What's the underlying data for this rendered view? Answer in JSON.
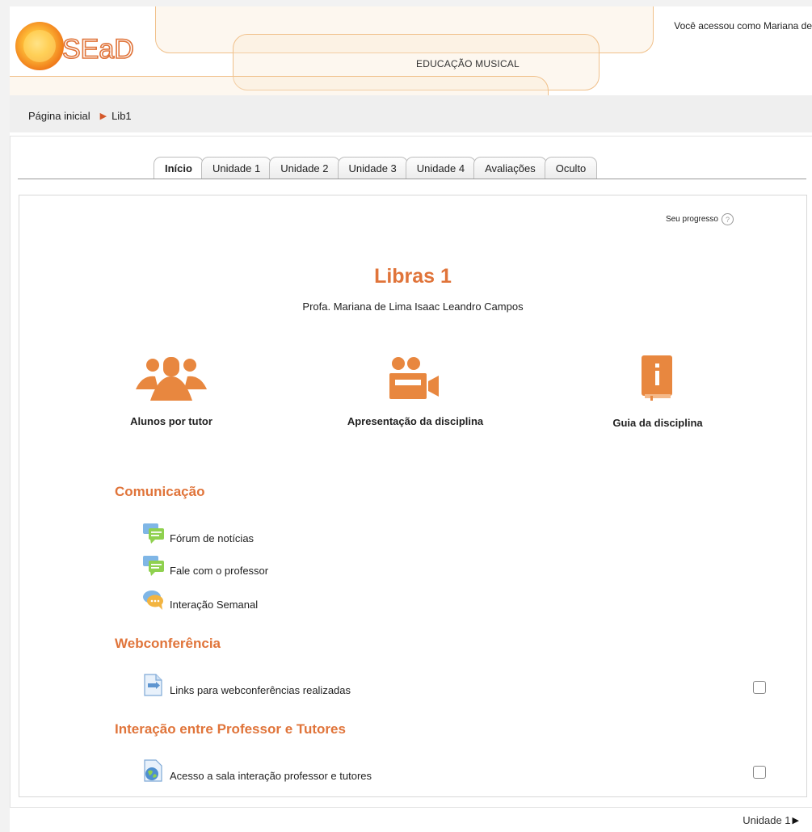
{
  "header": {
    "logo_text": "SEaD",
    "user_text": "Você acessou como Mariana de",
    "course_category": "EDUCAÇÃO MUSICAL"
  },
  "breadcrumb": {
    "home": "Página inicial",
    "current": "Lib1"
  },
  "tabs": [
    {
      "label": "Início",
      "active": true
    },
    {
      "label": "Unidade 1",
      "active": false
    },
    {
      "label": "Unidade 2",
      "active": false
    },
    {
      "label": "Unidade 3",
      "active": false
    },
    {
      "label": "Unidade 4",
      "active": false
    },
    {
      "label": "Avaliações",
      "active": false
    },
    {
      "label": "Oculto",
      "active": false
    }
  ],
  "progress": {
    "label": "Seu progresso",
    "help_icon": "?"
  },
  "course": {
    "title": "Libras 1",
    "teacher": "Profa. Mariana de Lima Isaac Leandro Campos"
  },
  "features": [
    {
      "label": "Alunos por tutor",
      "icon": "group-icon"
    },
    {
      "label": "Apresentação da disciplina",
      "icon": "video-camera-icon"
    },
    {
      "label": "Guia da disciplina",
      "icon": "book-info-icon"
    }
  ],
  "sections": [
    {
      "title": "Comunicação",
      "items": [
        {
          "label": "Fórum de notícias",
          "icon": "forum-icon"
        },
        {
          "label": "Fale com o professor",
          "icon": "forum-icon"
        },
        {
          "label": "Interação Semanal",
          "icon": "chat-icon"
        }
      ]
    },
    {
      "title": "Webconferência",
      "items": [
        {
          "label": "Links para webconferências realizadas",
          "icon": "url-icon",
          "checkbox": true
        }
      ]
    },
    {
      "title": "Interação entre Professor e Tutores",
      "items": [
        {
          "label": "Acesso a sala interação professor e tutores",
          "icon": "globe-icon",
          "checkbox": true
        }
      ]
    }
  ],
  "footer": {
    "next_label": "Unidade 1"
  },
  "colors": {
    "accent": "#e0743a",
    "icon_orange": "#e8873f",
    "header_line": "#f0c08a"
  }
}
